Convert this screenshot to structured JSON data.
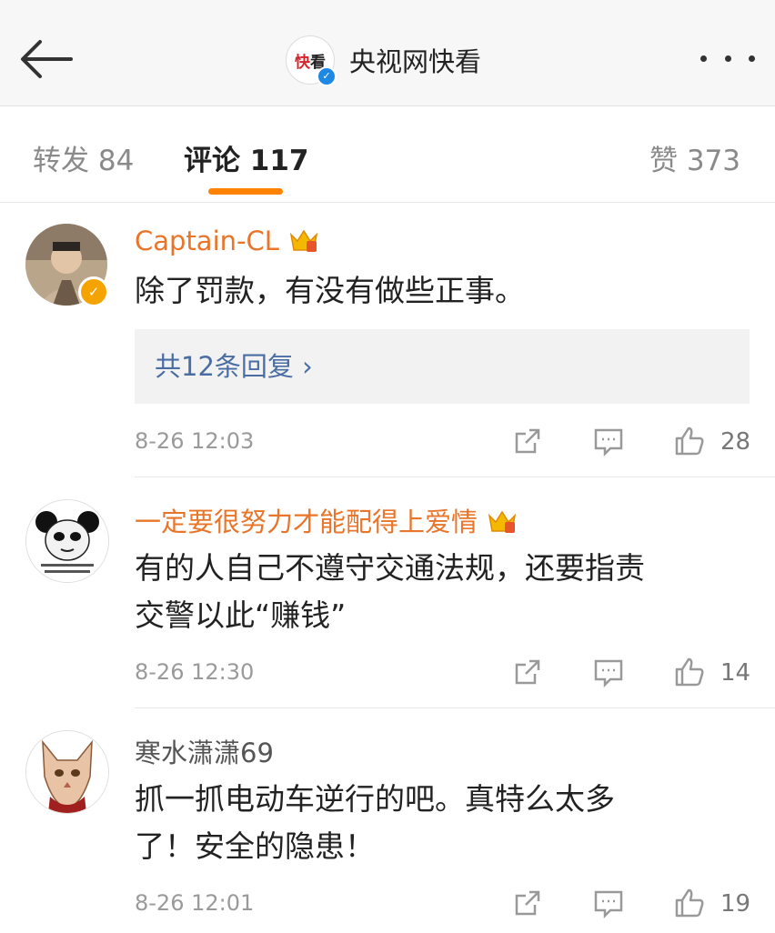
{
  "header": {
    "logo_text_red": "快",
    "logo_text": "看",
    "title": "央视网快看"
  },
  "tabs": [
    {
      "label": "转发 84"
    },
    {
      "label": "评论 117"
    },
    {
      "label": "赞 373"
    }
  ],
  "comments": [
    {
      "username": "Captain-CL",
      "text": "除了罚款，有没有做些正事。",
      "replies": "共12条回复 ›",
      "time": "8-26 12:03",
      "likes": "28"
    },
    {
      "username": "一定要很努力才能配得上爱情",
      "text_lines": [
        "有的人自己不遵守交通法规，还要指责",
        "交警以此“赚钱”"
      ],
      "time": "8-26 12:30",
      "likes": "14"
    },
    {
      "username": "寒水潇潇69",
      "text_lines": [
        "抓一抓电动车逆行的吧。真特么太多",
        "了！安全的隐患！"
      ],
      "time": "8-26 12:01",
      "likes": "19"
    }
  ],
  "colors": {
    "accent": "#ff8200",
    "username_vip": "#e8752a",
    "reply_link": "#4a6ea3"
  }
}
